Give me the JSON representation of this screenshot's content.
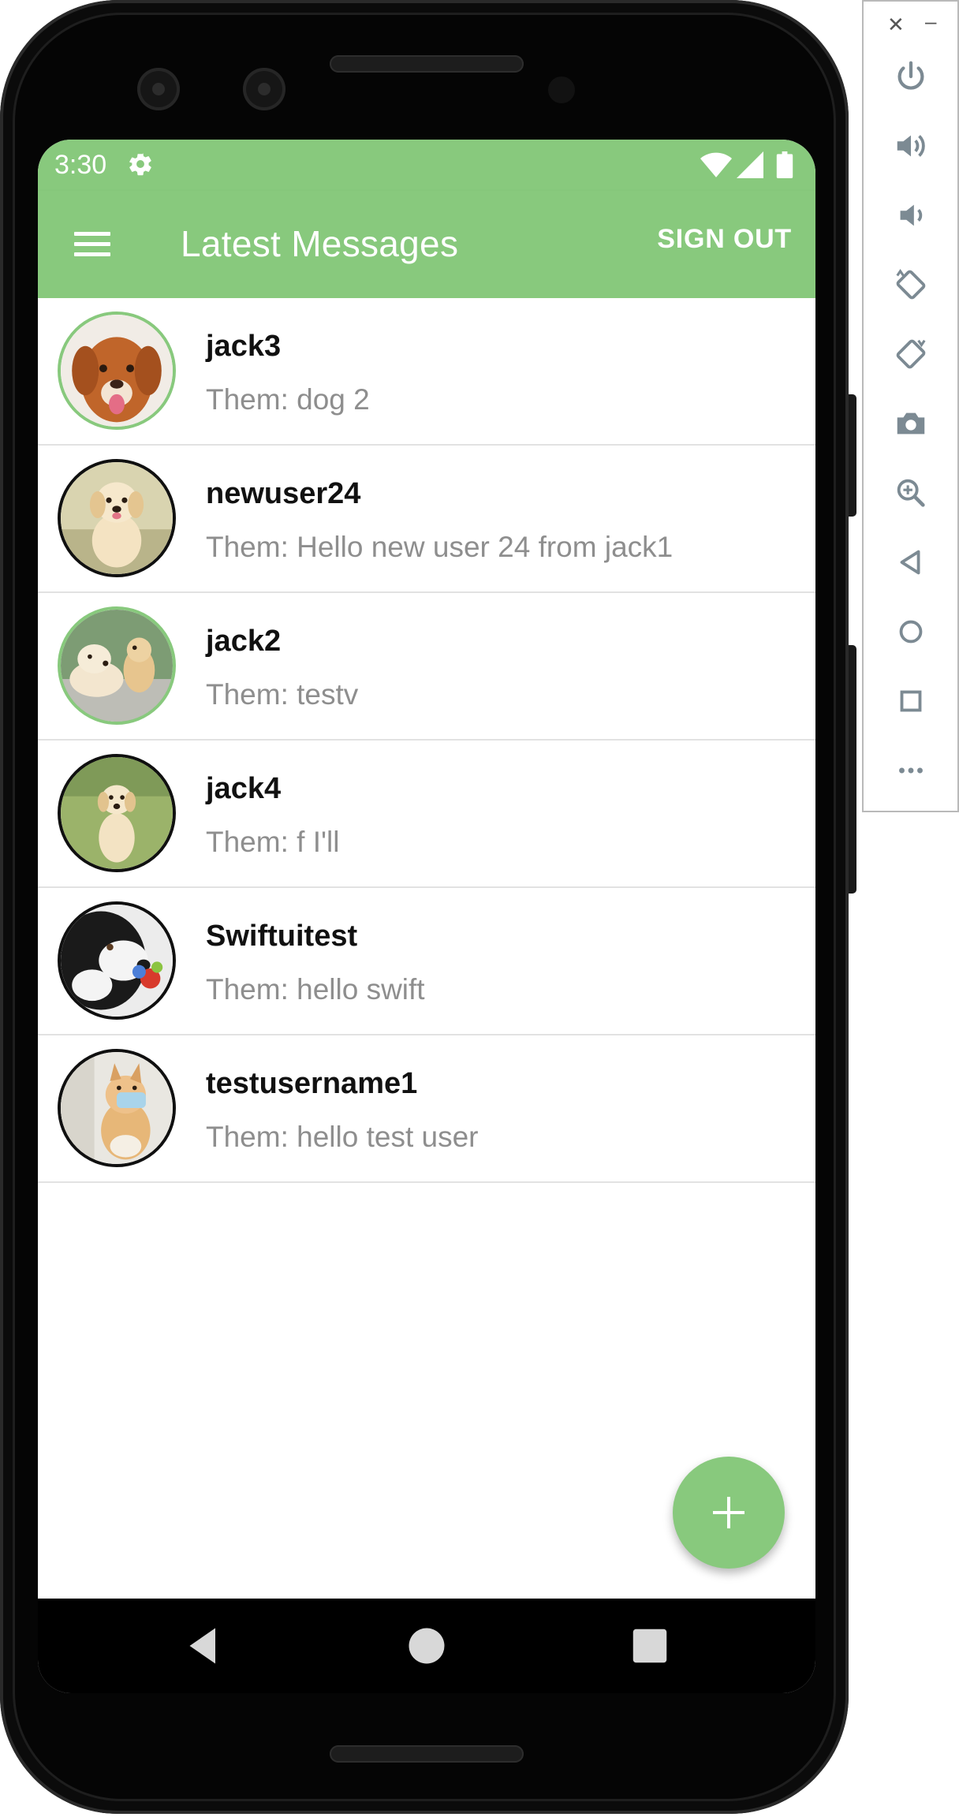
{
  "status_bar": {
    "time": "3:30"
  },
  "app_bar": {
    "title": "Latest Messages",
    "signout_label": "SIGN OUT"
  },
  "conversations": [
    {
      "name": "jack3",
      "preview": "Them: dog 2",
      "avatar": "dog-avatar-retriever-red",
      "unread": true
    },
    {
      "name": "newuser24",
      "preview": "Them: Hello new user 24 from jack1",
      "avatar": "dog-avatar-golden-puppy-running",
      "unread": false
    },
    {
      "name": "jack2",
      "preview": "Them: testv",
      "avatar": "dog-avatar-two-golden-puppies",
      "unread": true
    },
    {
      "name": "jack4",
      "preview": "Them: f I'll",
      "avatar": "dog-avatar-golden-puppy-grass",
      "unread": false
    },
    {
      "name": "Swiftuitest",
      "preview": "Them: hello swift",
      "avatar": "dog-avatar-border-collie-ball",
      "unread": false
    },
    {
      "name": "testusername1",
      "preview": "Them: hello test user",
      "avatar": "dog-avatar-pomeranian-mask",
      "unread": false
    }
  ],
  "fab": {
    "icon": "plus-icon"
  },
  "colors": {
    "accent": "#88c97d",
    "unread_ring": "#88c97d",
    "read_ring": "#101010",
    "preview_text": "#8e8e8e"
  },
  "emulator_panel": {
    "icons": [
      "close-icon",
      "minimize-icon",
      "power-icon",
      "volume-up-icon",
      "volume-down-icon",
      "rotate-left-icon",
      "rotate-right-icon",
      "camera-icon",
      "zoom-icon",
      "back-icon",
      "home-icon",
      "overview-icon",
      "more-icon"
    ]
  }
}
